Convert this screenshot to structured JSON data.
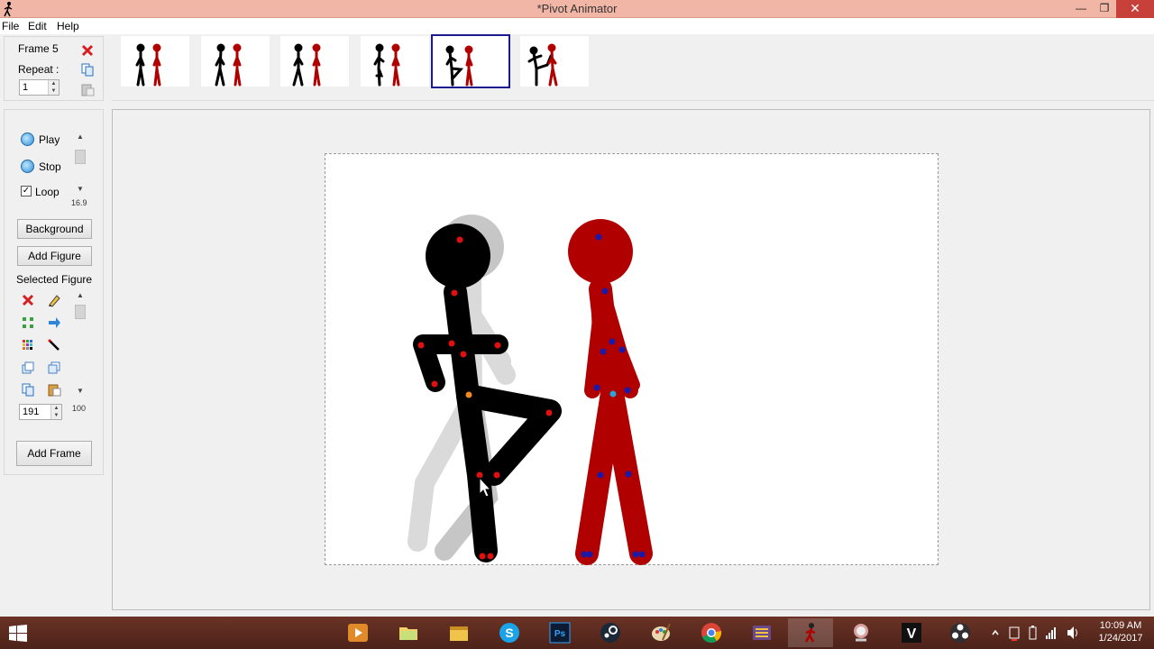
{
  "window": {
    "title": "*Pivot Animator",
    "minimize": "—",
    "maximize": "❐",
    "close": "✕"
  },
  "menu": [
    "File",
    "Edit",
    "Help"
  ],
  "frame_panel": {
    "frame_label": "Frame 5",
    "repeat_label": "Repeat :",
    "repeat_value": "1"
  },
  "timeline": {
    "frame_count": 6,
    "selected_frame": 5
  },
  "playback": {
    "play_label": "Play",
    "stop_label": "Stop",
    "loop_label": "Loop",
    "loop_checked": true,
    "speed_value": "16.9"
  },
  "buttons": {
    "background": "Background",
    "add_figure": "Add Figure",
    "add_frame": "Add Frame"
  },
  "selected_figure": {
    "label": "Selected Figure",
    "size_value": "191",
    "scale_value": "100"
  },
  "clock": {
    "time": "10:09 AM",
    "date": "1/24/2017"
  },
  "colors": {
    "titlebar": "#f2b6a6",
    "close": "#c7403a",
    "figure_black": "#000000",
    "figure_red": "#b00000",
    "joint_red": "#e01010",
    "joint_blue": "#1a1aaa",
    "selection": "#1b1b8f",
    "taskbar": "#5a2a20"
  },
  "taskbar_icons": [
    "start-icon",
    "media-player-icon",
    "folder-icon",
    "file-explorer-icon",
    "skype-icon",
    "photoshop-icon",
    "steam-icon",
    "paint-icon",
    "chrome-icon",
    "video-editor-icon",
    "pivot-animator-icon",
    "character-icon",
    "v-app-icon",
    "obs-icon"
  ]
}
